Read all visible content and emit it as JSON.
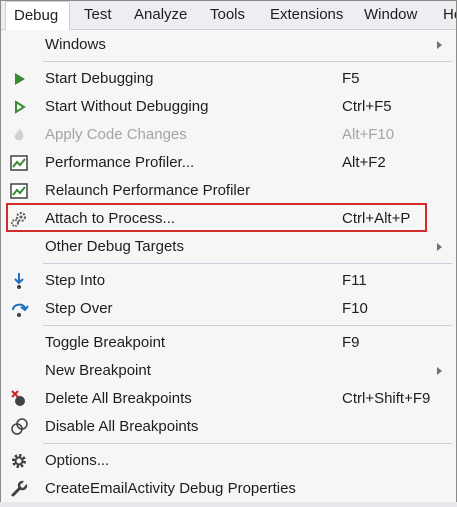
{
  "menubar": {
    "tabs": [
      "Debug",
      "Test",
      "Analyze",
      "Tools",
      "Extensions",
      "Window",
      "He"
    ]
  },
  "menu": {
    "windows": {
      "label": "Windows"
    },
    "start_debugging": {
      "label": "Start Debugging",
      "shortcut": "F5"
    },
    "start_without_debugging": {
      "label": "Start Without Debugging",
      "shortcut": "Ctrl+F5"
    },
    "apply_code_changes": {
      "label": "Apply Code Changes",
      "shortcut": "Alt+F10"
    },
    "performance_profiler": {
      "label": "Performance Profiler...",
      "shortcut": "Alt+F2"
    },
    "relaunch_performance_profiler": {
      "label": "Relaunch Performance Profiler"
    },
    "attach_to_process": {
      "label": "Attach to Process...",
      "shortcut": "Ctrl+Alt+P"
    },
    "other_debug_targets": {
      "label": "Other Debug Targets"
    },
    "step_into": {
      "label": "Step Into",
      "shortcut": "F11"
    },
    "step_over": {
      "label": "Step Over",
      "shortcut": "F10"
    },
    "toggle_breakpoint": {
      "label": "Toggle Breakpoint",
      "shortcut": "F9"
    },
    "new_breakpoint": {
      "label": "New Breakpoint"
    },
    "delete_all_breakpoints": {
      "label": "Delete All Breakpoints",
      "shortcut": "Ctrl+Shift+F9"
    },
    "disable_all_breakpoints": {
      "label": "Disable All Breakpoints"
    },
    "options": {
      "label": "Options..."
    },
    "debug_properties": {
      "label": "CreateEmailActivity Debug Properties"
    }
  },
  "colors": {
    "play_green": "#388a34",
    "highlight_red": "#d42a2a",
    "step_blue": "#1e6fbf",
    "breakpoint_red": "#c72c2c"
  },
  "icons": {
    "start_debugging": "play-filled-icon",
    "start_without_debugging": "play-outline-icon",
    "apply_code_changes": "flame-icon",
    "performance_profiler": "profiler-chart-icon",
    "relaunch_performance_profiler": "profiler-chart-icon",
    "attach_to_process": "gears-icon",
    "step_into": "step-into-icon",
    "step_over": "step-over-icon",
    "delete_all_breakpoints": "delete-breakpoints-icon",
    "disable_all_breakpoints": "disable-breakpoints-icon",
    "options": "gear-icon",
    "debug_properties": "wrench-icon"
  }
}
